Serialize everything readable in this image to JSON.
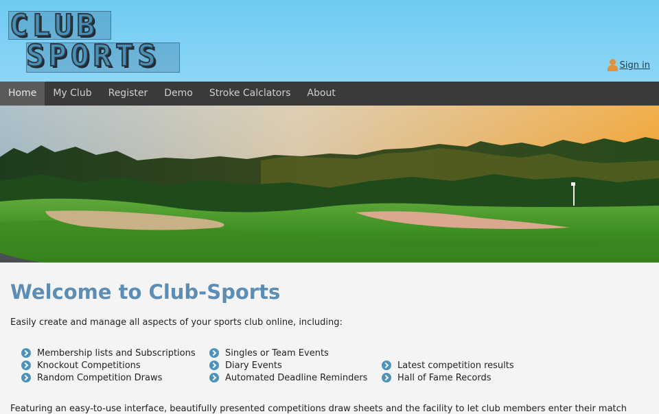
{
  "header": {
    "logo_line1": "CLUB",
    "logo_line2": "SPORTS",
    "signin_label": "Sign in"
  },
  "nav": {
    "items": [
      {
        "label": "Home",
        "active": true
      },
      {
        "label": "My Club"
      },
      {
        "label": "Register"
      },
      {
        "label": "Demo"
      },
      {
        "label": "Stroke Calclators"
      },
      {
        "label": "About"
      }
    ]
  },
  "main": {
    "title": "Welcome to Club-Sports",
    "intro": "Easily create and manage all aspects of your sports club online, including:",
    "features": [
      "Membership lists and Subscriptions",
      "Knockout Competitions",
      "Random Competition Draws",
      "Singles or Team Events",
      "Diary Events",
      "Automated Deadline Reminders",
      "Latest competition results",
      "Hall of Fame Records"
    ],
    "footer": "Featuring an easy-to-use interface, beautifully presented competitions draw sheets and the facility to let club members enter their match"
  },
  "colors": {
    "header_bg": "#6fcbf2",
    "nav_bg": "#3a3a3a",
    "title": "#5b8db5",
    "bullet": "#4d92b8",
    "user_icon": "#e2913a"
  },
  "icons": [
    "user-icon",
    "arrow-bullet-icon"
  ]
}
